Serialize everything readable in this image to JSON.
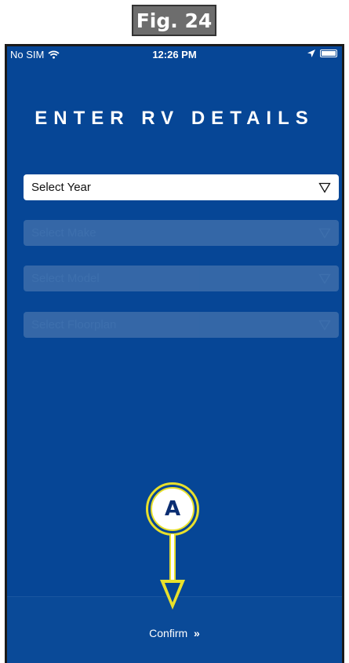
{
  "figure": {
    "label": "Fig. 24"
  },
  "status_bar": {
    "carrier": "No SIM",
    "time": "12:26 PM"
  },
  "screen": {
    "title": "ENTER RV DETAILS",
    "selects": {
      "year": {
        "label": "Select Year",
        "enabled": true
      },
      "make": {
        "label": "Select Make",
        "enabled": false
      },
      "model": {
        "label": "Select Model",
        "enabled": false
      },
      "floorplan": {
        "label": "Select Floorplan",
        "enabled": false
      }
    },
    "confirm_label": "Confirm",
    "confirm_icon": "double-chevron-right-icon"
  },
  "callout": {
    "label": "A"
  },
  "colors": {
    "background": "#064696",
    "callout_accent": "#e8e02c",
    "callout_text": "#0b2e72"
  }
}
